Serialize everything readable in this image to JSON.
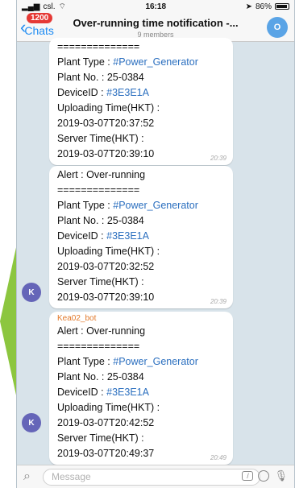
{
  "status_bar": {
    "carrier": "csl.",
    "time": "16:18",
    "battery": "86%"
  },
  "header": {
    "back_label": "Chats",
    "unread_badge": "1200",
    "title": "Over-running time notification -...",
    "subtitle": "9 members",
    "avatar_initial": "O"
  },
  "messages": [
    {
      "lines": [
        {
          "text": "=============="
        },
        {
          "label": "Plant Type : ",
          "value": "#Power_Generator"
        },
        {
          "text": "Plant No. : 25-0384"
        },
        {
          "label": "DeviceID : ",
          "value": "#3E3E1A"
        },
        {
          "text": "Uploading Time(HKT) :"
        },
        {
          "text": "2019-03-07T20:37:52"
        },
        {
          "text": "Server Time(HKT) :"
        },
        {
          "text": "2019-03-07T20:39:10"
        }
      ],
      "time": "20:39"
    },
    {
      "lines": [
        {
          "text": "Alert : Over-running"
        },
        {
          "text": "=============="
        },
        {
          "label": "Plant Type : ",
          "value": "#Power_Generator"
        },
        {
          "text": "Plant No. : 25-0384"
        },
        {
          "label": "DeviceID : ",
          "value": "#3E3E1A"
        },
        {
          "text": "Uploading Time(HKT) :"
        },
        {
          "text": "2019-03-07T20:32:52"
        },
        {
          "text": "Server Time(HKT) :"
        },
        {
          "text": "2019-03-07T20:39:10"
        }
      ],
      "time": "20:39",
      "avatar": "K"
    },
    {
      "sender": "Kea02_bot",
      "lines": [
        {
          "text": "Alert : Over-running"
        },
        {
          "text": "=============="
        },
        {
          "label": "Plant Type : ",
          "value": "#Power_Generator"
        },
        {
          "text": "Plant No. : 25-0384"
        },
        {
          "label": "DeviceID : ",
          "value": "#3E3E1A"
        },
        {
          "text": "Uploading Time(HKT) :"
        },
        {
          "text": "2019-03-07T20:42:52"
        },
        {
          "text": "Server Time(HKT) :"
        },
        {
          "text": "2019-03-07T20:49:37"
        }
      ],
      "time": "20:49",
      "avatar": "K"
    }
  ],
  "input": {
    "placeholder": "Message"
  },
  "colors": {
    "link": "#2b6fbf",
    "accent": "#1f8cf2",
    "badge": "#e53935",
    "sender": "#e2792b",
    "arrow": "#8cc63f"
  }
}
